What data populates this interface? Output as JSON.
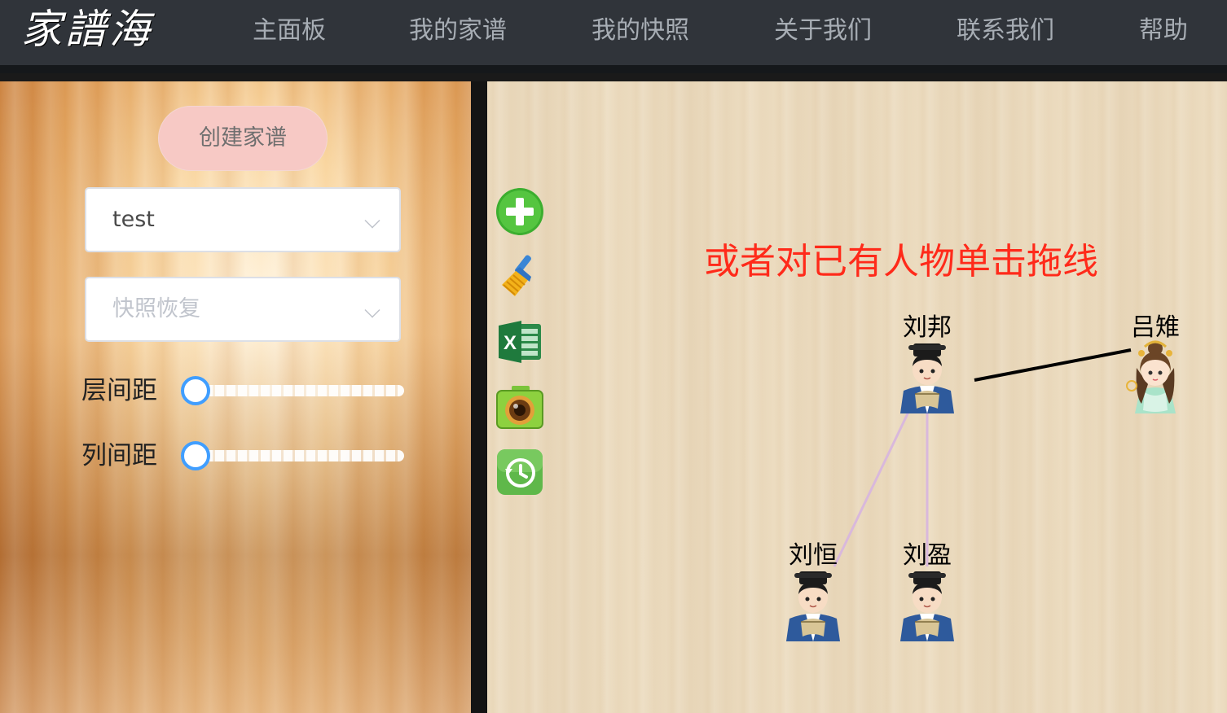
{
  "logo": "家譜海",
  "nav": {
    "items": [
      {
        "label": "主面板"
      },
      {
        "label": "我的家谱"
      },
      {
        "label": "我的快照"
      },
      {
        "label": "关于我们"
      },
      {
        "label": "联系我们"
      },
      {
        "label": "帮助"
      }
    ]
  },
  "sidebar": {
    "create_button": "创建家谱",
    "tree_select": {
      "value": "test"
    },
    "snapshot_select": {
      "placeholder": "快照恢复"
    },
    "layer_spacing": {
      "label": "层间距",
      "value": 0
    },
    "column_spacing": {
      "label": "列间距",
      "value": 0
    }
  },
  "colors": {
    "nav_bg": "#30343a",
    "nav_text": "#a7adb4",
    "create_button_bg": "#f7c9c5",
    "slider_accent": "#409eff",
    "hint_text": "#ff2a1a",
    "spouse_edge": "#000000",
    "child_edge": "#d9b8dc"
  },
  "canvas": {
    "tools": [
      {
        "icon": "add-person-icon"
      },
      {
        "icon": "clear-broom-icon"
      },
      {
        "icon": "excel-export-icon"
      },
      {
        "icon": "camera-snapshot-icon"
      },
      {
        "icon": "restore-history-icon"
      }
    ],
    "hint": "或者对已有人物单击拖线",
    "people": [
      {
        "name": "刘邦",
        "gender": "male"
      },
      {
        "name": "吕雉",
        "gender": "female"
      },
      {
        "name": "刘恒",
        "gender": "male"
      },
      {
        "name": "刘盈",
        "gender": "male"
      }
    ],
    "relations": [
      {
        "type": "spouse",
        "from": "刘邦",
        "to": "吕雉"
      },
      {
        "type": "child",
        "from": "刘邦",
        "to": "刘恒"
      },
      {
        "type": "child",
        "from": "刘邦",
        "to": "刘盈"
      }
    ]
  }
}
